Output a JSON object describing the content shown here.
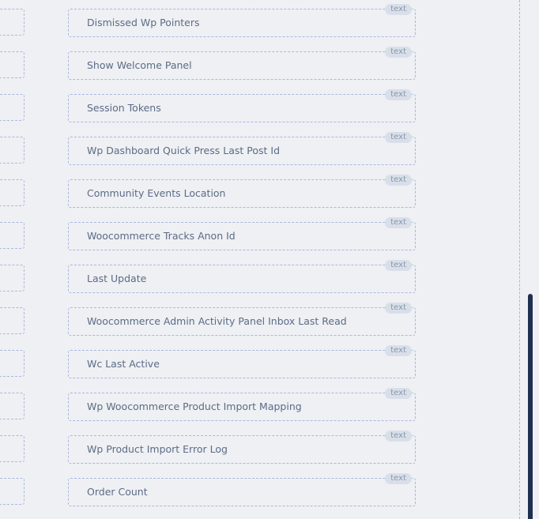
{
  "fields": [
    {
      "label": "Dismissed Wp Pointers",
      "type_badge": "text"
    },
    {
      "label": "Show Welcome Panel",
      "type_badge": "text"
    },
    {
      "label": "Session Tokens",
      "type_badge": "text"
    },
    {
      "label": "Wp Dashboard Quick Press Last Post Id",
      "type_badge": "text"
    },
    {
      "label": "Community Events Location",
      "type_badge": "text"
    },
    {
      "label": "Woocommerce Tracks Anon Id",
      "type_badge": "text"
    },
    {
      "label": "Last Update",
      "type_badge": "text"
    },
    {
      "label": "Woocommerce Admin Activity Panel Inbox Last Read",
      "type_badge": "text"
    },
    {
      "label": "Wc Last Active",
      "type_badge": "text"
    },
    {
      "label": "Wp Woocommerce Product Import Mapping",
      "type_badge": "text"
    },
    {
      "label": "Wp Product Import Error Log",
      "type_badge": "text"
    },
    {
      "label": "Order Count",
      "type_badge": "text"
    }
  ]
}
